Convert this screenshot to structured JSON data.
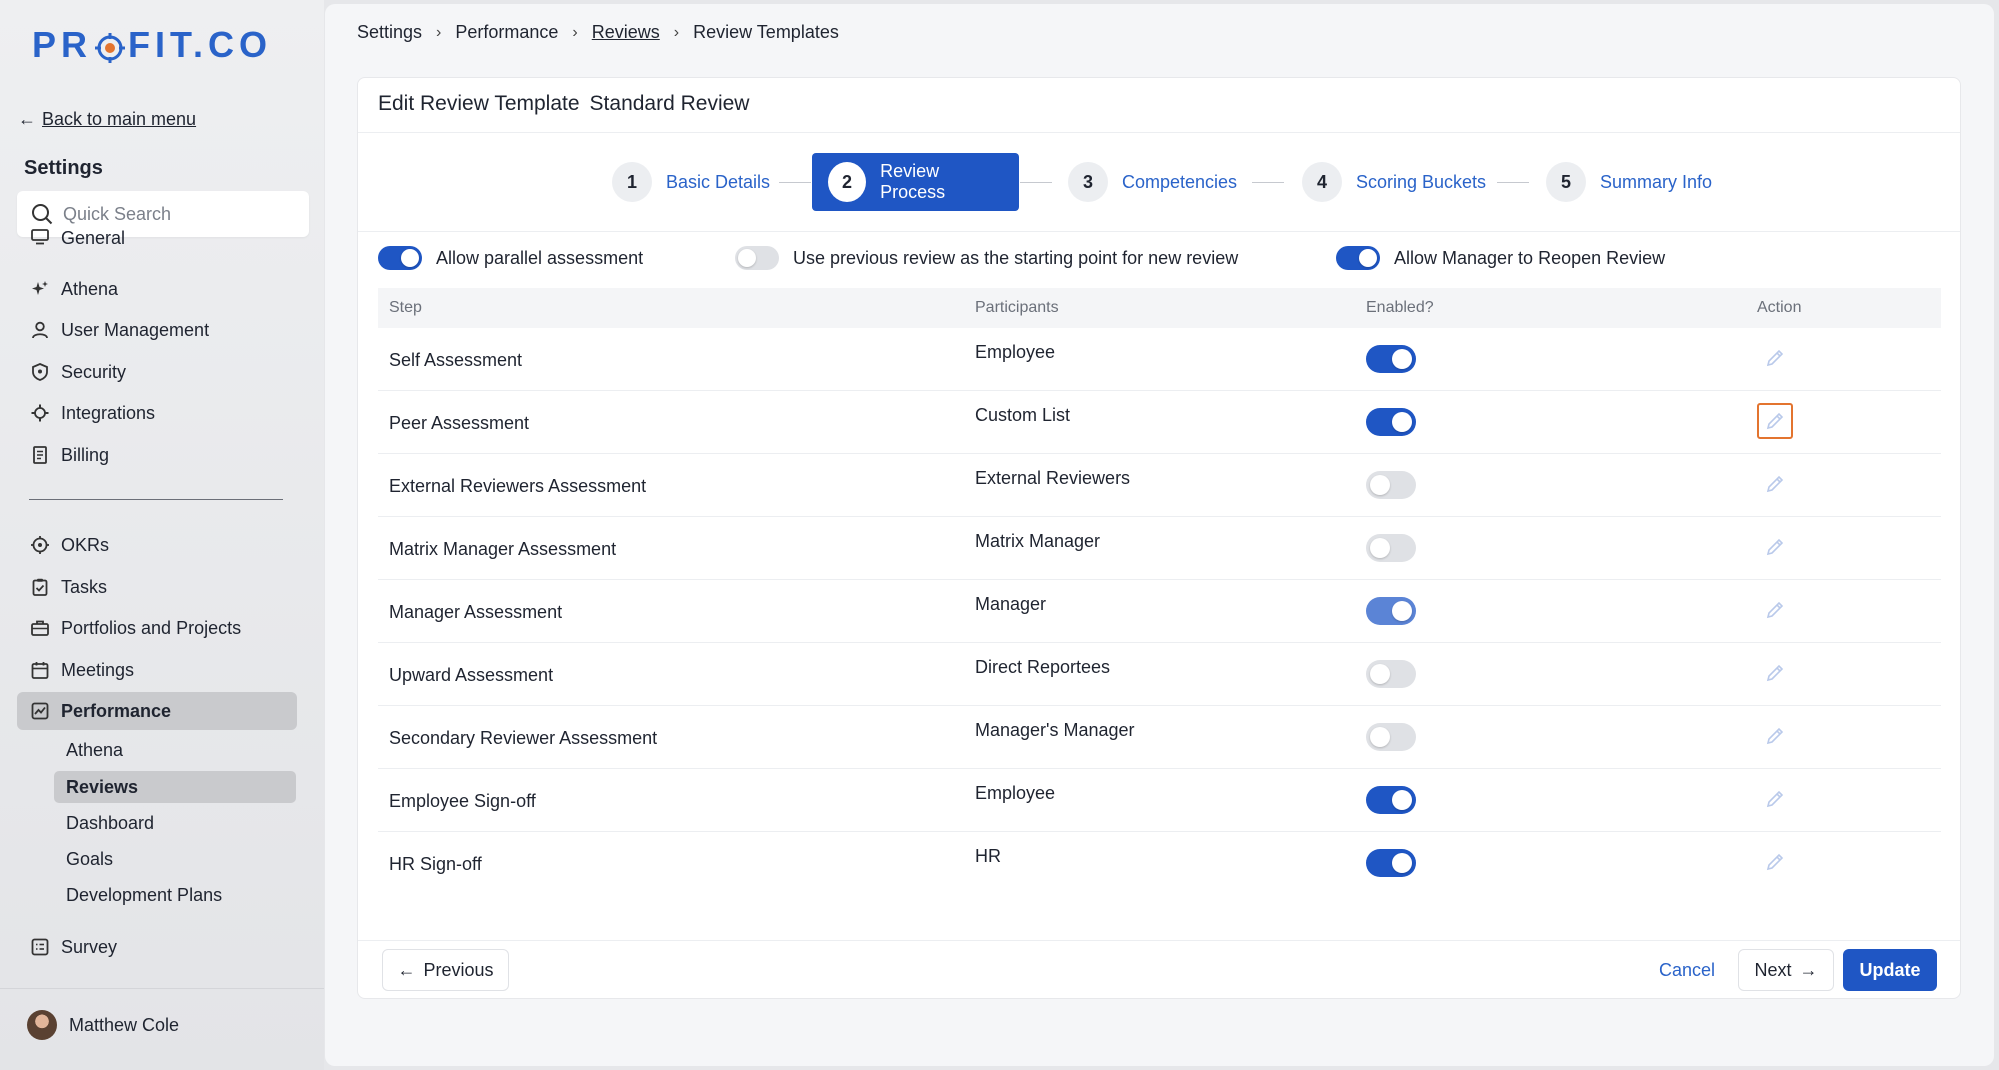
{
  "brand": {
    "logo_text_left": "PR",
    "logo_text_right": "FIT.CO",
    "accent": "#1f56c4"
  },
  "sidebar": {
    "back_label": "Back to main menu",
    "heading": "Settings",
    "search_placeholder": "Quick Search",
    "items": [
      {
        "label": "General",
        "icon": "monitor-icon"
      },
      {
        "label": "Athena",
        "icon": "sparkle-icon"
      },
      {
        "label": "User Management",
        "icon": "user-icon"
      },
      {
        "label": "Security",
        "icon": "shield-icon"
      },
      {
        "label": "Integrations",
        "icon": "gear-icon"
      },
      {
        "label": "Billing",
        "icon": "receipt-icon"
      }
    ],
    "modules": [
      {
        "label": "OKRs",
        "icon": "target-icon"
      },
      {
        "label": "Tasks",
        "icon": "clipboard-check-icon"
      },
      {
        "label": "Portfolios and Projects",
        "icon": "briefcase-icon"
      },
      {
        "label": "Meetings",
        "icon": "calendar-icon"
      },
      {
        "label": "Performance",
        "icon": "chart-icon"
      }
    ],
    "performance_sub": [
      "Athena",
      "Reviews",
      "Dashboard",
      "Goals",
      "Development Plans"
    ],
    "survey_label": "Survey",
    "user_name": "Matthew Cole"
  },
  "breadcrumb": [
    "Settings",
    "Performance",
    "Reviews",
    "Review Templates"
  ],
  "page": {
    "title": "Edit Review Template",
    "template_name": "Standard Review"
  },
  "steps": [
    {
      "num": "1",
      "label": "Basic Details"
    },
    {
      "num": "2",
      "label": "Review Process"
    },
    {
      "num": "3",
      "label": "Competencies"
    },
    {
      "num": "4",
      "label": "Scoring Buckets"
    },
    {
      "num": "5",
      "label": "Summary Info"
    }
  ],
  "options": {
    "parallel": "Allow parallel assessment",
    "previous": "Use previous review as the starting point for new review",
    "reopen": "Allow Manager to Reopen Review"
  },
  "table": {
    "headers": [
      "Step",
      "Participants",
      "Enabled?",
      "Action"
    ],
    "rows": [
      {
        "step": "Self Assessment",
        "participants": "Employee",
        "enabled": true
      },
      {
        "step": "Peer Assessment",
        "participants": "Custom List",
        "enabled": true
      },
      {
        "step": "External Reviewers Assessment",
        "participants": "External Reviewers",
        "enabled": false
      },
      {
        "step": "Matrix Manager Assessment",
        "participants": "Matrix Manager",
        "enabled": false
      },
      {
        "step": "Manager Assessment",
        "participants": "Manager",
        "enabled": true
      },
      {
        "step": "Upward Assessment",
        "participants": "Direct Reportees",
        "enabled": false
      },
      {
        "step": "Secondary Reviewer Assessment",
        "participants": "Manager's Manager",
        "enabled": false
      },
      {
        "step": "Employee Sign-off",
        "participants": "Employee",
        "enabled": true
      },
      {
        "step": "HR Sign-off",
        "participants": "HR",
        "enabled": true
      }
    ]
  },
  "footer": {
    "previous": "Previous",
    "cancel": "Cancel",
    "next": "Next",
    "update": "Update"
  }
}
